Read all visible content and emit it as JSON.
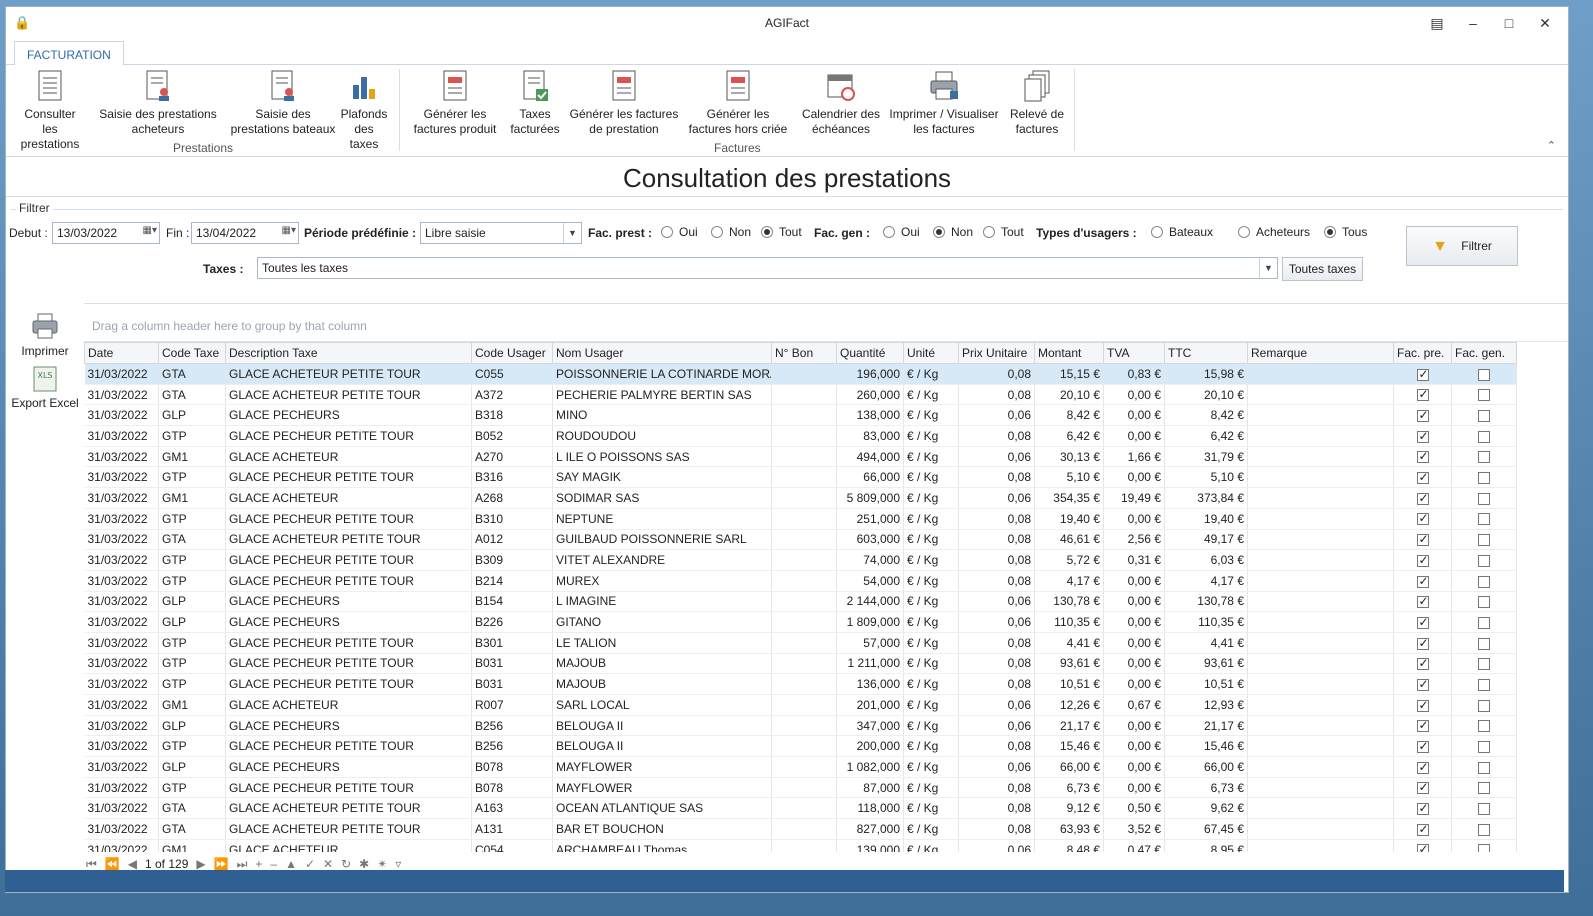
{
  "window": {
    "title": "AGIFact"
  },
  "tab": {
    "label": "FACTURATION"
  },
  "ribbon": {
    "groups": [
      {
        "label": "Prestations"
      },
      {
        "label": "Factures"
      }
    ],
    "buttons": [
      {
        "l1": "Consulter les",
        "l2": "prestations",
        "icon": "list-document-icon"
      },
      {
        "l1": "Saisie des prestations",
        "l2": "acheteurs",
        "icon": "user-document-icon"
      },
      {
        "l1": "Saisie des",
        "l2": "prestations bateaux",
        "icon": "user-document-icon"
      },
      {
        "l1": "Plafonds",
        "l2": "des taxes",
        "icon": "bar-chart-icon"
      },
      {
        "l1": "Générer les",
        "l2": "factures produit",
        "icon": "invoice-icon"
      },
      {
        "l1": "Taxes",
        "l2": "facturées",
        "icon": "check-document-icon"
      },
      {
        "l1": "Générer les factures",
        "l2": "de prestation",
        "icon": "invoice-icon"
      },
      {
        "l1": "Générer les",
        "l2": "factures hors criée",
        "icon": "invoice-icon"
      },
      {
        "l1": "Calendrier des",
        "l2": "échéances",
        "icon": "calendar-icon"
      },
      {
        "l1": "Imprimer / Visualiser",
        "l2": "les factures",
        "icon": "printer-icon"
      },
      {
        "l1": "Relevé de",
        "l2": "factures",
        "icon": "copy-documents-icon"
      }
    ]
  },
  "page": {
    "title": "Consultation des prestations"
  },
  "filter": {
    "legend": "Filtrer",
    "debut_label": "Debut :",
    "debut_value": "13/03/2022",
    "fin_label": "Fin :",
    "fin_value": "13/04/2022",
    "periode_label": "Période prédéfinie :",
    "periode_value": "Libre saisie",
    "fac_prest_label": "Fac. prest :",
    "fac_gen_label": "Fac. gen :",
    "types_label": "Types d'usagers :",
    "opt_oui": "Oui",
    "opt_non": "Non",
    "opt_tout": "Tout",
    "opt_bateaux": "Bateaux",
    "opt_acheteurs": "Acheteurs",
    "opt_tous": "Tous",
    "taxes_label": "Taxes :",
    "taxes_value": "Toutes les taxes",
    "toutes_taxes_button": "Toutes taxes",
    "filtrer_button": "Filtrer",
    "fac_prest_selected": "Tout",
    "fac_gen_selected": "Non",
    "types_selected": "Tous"
  },
  "side": {
    "print_label": "Imprimer",
    "excel_label": "Export Excel"
  },
  "grid": {
    "group_hint": "Drag a column header here to group by that column",
    "columns": [
      "Date",
      "Code Taxe",
      "Description Taxe",
      "Code Usager",
      "Nom Usager",
      "N° Bon",
      "Quantité",
      "Unité",
      "Prix Unitaire",
      "Montant",
      "TVA",
      "TTC",
      "Remarque",
      "Fac. pre.",
      "Fac. gen."
    ],
    "rows": [
      [
        "31/03/2022",
        "GTA",
        "GLACE ACHETEUR PETITE TOUR",
        "C055",
        "POISSONNERIE LA COTINARDE MORAI",
        "",
        "196,000",
        "€ / Kg",
        "0,08",
        "15,15 €",
        "0,83 €",
        "15,98 €",
        "",
        true,
        false
      ],
      [
        "31/03/2022",
        "GTA",
        "GLACE ACHETEUR PETITE TOUR",
        "A372",
        "PECHERIE PALMYRE BERTIN SAS",
        "",
        "260,000",
        "€ / Kg",
        "0,08",
        "20,10 €",
        "0,00 €",
        "20,10 €",
        "",
        true,
        false
      ],
      [
        "31/03/2022",
        "GLP",
        "GLACE PECHEURS",
        "B318",
        "MINO",
        "",
        "138,000",
        "€ / Kg",
        "0,06",
        "8,42 €",
        "0,00 €",
        "8,42 €",
        "",
        true,
        false
      ],
      [
        "31/03/2022",
        "GTP",
        "GLACE PECHEUR PETITE TOUR",
        "B052",
        "ROUDOUDOU",
        "",
        "83,000",
        "€ / Kg",
        "0,08",
        "6,42 €",
        "0,00 €",
        "6,42 €",
        "",
        true,
        false
      ],
      [
        "31/03/2022",
        "GM1",
        "GLACE ACHETEUR",
        "A270",
        "L ILE O POISSONS SAS",
        "",
        "494,000",
        "€ / Kg",
        "0,06",
        "30,13 €",
        "1,66 €",
        "31,79 €",
        "",
        true,
        false
      ],
      [
        "31/03/2022",
        "GTP",
        "GLACE PECHEUR PETITE TOUR",
        "B316",
        "SAY MAGIK",
        "",
        "66,000",
        "€ / Kg",
        "0,08",
        "5,10 €",
        "0,00 €",
        "5,10 €",
        "",
        true,
        false
      ],
      [
        "31/03/2022",
        "GM1",
        "GLACE ACHETEUR",
        "A268",
        "SODIMAR SAS",
        "",
        "5 809,000",
        "€ / Kg",
        "0,06",
        "354,35 €",
        "19,49 €",
        "373,84 €",
        "",
        true,
        false
      ],
      [
        "31/03/2022",
        "GTP",
        "GLACE PECHEUR PETITE TOUR",
        "B310",
        "NEPTUNE",
        "",
        "251,000",
        "€ / Kg",
        "0,08",
        "19,40 €",
        "0,00 €",
        "19,40 €",
        "",
        true,
        false
      ],
      [
        "31/03/2022",
        "GTA",
        "GLACE ACHETEUR PETITE TOUR",
        "A012",
        "GUILBAUD POISSONNERIE SARL",
        "",
        "603,000",
        "€ / Kg",
        "0,08",
        "46,61 €",
        "2,56 €",
        "49,17 €",
        "",
        true,
        false
      ],
      [
        "31/03/2022",
        "GTP",
        "GLACE PECHEUR PETITE TOUR",
        "B309",
        "VITET ALEXANDRE",
        "",
        "74,000",
        "€ / Kg",
        "0,08",
        "5,72 €",
        "0,31 €",
        "6,03 €",
        "",
        true,
        false
      ],
      [
        "31/03/2022",
        "GTP",
        "GLACE PECHEUR PETITE TOUR",
        "B214",
        "MUREX",
        "",
        "54,000",
        "€ / Kg",
        "0,08",
        "4,17 €",
        "0,00 €",
        "4,17 €",
        "",
        true,
        false
      ],
      [
        "31/03/2022",
        "GLP",
        "GLACE PECHEURS",
        "B154",
        "L IMAGINE",
        "",
        "2 144,000",
        "€ / Kg",
        "0,06",
        "130,78 €",
        "0,00 €",
        "130,78 €",
        "",
        true,
        false
      ],
      [
        "31/03/2022",
        "GLP",
        "GLACE PECHEURS",
        "B226",
        "GITANO",
        "",
        "1 809,000",
        "€ / Kg",
        "0,06",
        "110,35 €",
        "0,00 €",
        "110,35 €",
        "",
        true,
        false
      ],
      [
        "31/03/2022",
        "GTP",
        "GLACE PECHEUR PETITE TOUR",
        "B301",
        "LE TALION",
        "",
        "57,000",
        "€ / Kg",
        "0,08",
        "4,41 €",
        "0,00 €",
        "4,41 €",
        "",
        true,
        false
      ],
      [
        "31/03/2022",
        "GTP",
        "GLACE PECHEUR PETITE TOUR",
        "B031",
        "MAJOUB",
        "",
        "1 211,000",
        "€ / Kg",
        "0,08",
        "93,61 €",
        "0,00 €",
        "93,61 €",
        "",
        true,
        false
      ],
      [
        "31/03/2022",
        "GTP",
        "GLACE PECHEUR PETITE TOUR",
        "B031",
        "MAJOUB",
        "",
        "136,000",
        "€ / Kg",
        "0,08",
        "10,51 €",
        "0,00 €",
        "10,51 €",
        "",
        true,
        false
      ],
      [
        "31/03/2022",
        "GM1",
        "GLACE ACHETEUR",
        "R007",
        "SARL LOCAL",
        "",
        "201,000",
        "€ / Kg",
        "0,06",
        "12,26 €",
        "0,67 €",
        "12,93 €",
        "",
        true,
        false
      ],
      [
        "31/03/2022",
        "GLP",
        "GLACE PECHEURS",
        "B256",
        "BELOUGA II",
        "",
        "347,000",
        "€ / Kg",
        "0,06",
        "21,17 €",
        "0,00 €",
        "21,17 €",
        "",
        true,
        false
      ],
      [
        "31/03/2022",
        "GTP",
        "GLACE PECHEUR PETITE TOUR",
        "B256",
        "BELOUGA II",
        "",
        "200,000",
        "€ / Kg",
        "0,08",
        "15,46 €",
        "0,00 €",
        "15,46 €",
        "",
        true,
        false
      ],
      [
        "31/03/2022",
        "GLP",
        "GLACE PECHEURS",
        "B078",
        "MAYFLOWER",
        "",
        "1 082,000",
        "€ / Kg",
        "0,06",
        "66,00 €",
        "0,00 €",
        "66,00 €",
        "",
        true,
        false
      ],
      [
        "31/03/2022",
        "GTP",
        "GLACE PECHEUR PETITE TOUR",
        "B078",
        "MAYFLOWER",
        "",
        "87,000",
        "€ / Kg",
        "0,08",
        "6,73 €",
        "0,00 €",
        "6,73 €",
        "",
        true,
        false
      ],
      [
        "31/03/2022",
        "GTA",
        "GLACE ACHETEUR PETITE TOUR",
        "A163",
        "OCEAN ATLANTIQUE SAS",
        "",
        "118,000",
        "€ / Kg",
        "0,08",
        "9,12 €",
        "0,50 €",
        "9,62 €",
        "",
        true,
        false
      ],
      [
        "31/03/2022",
        "GTA",
        "GLACE ACHETEUR PETITE TOUR",
        "A131",
        "BAR ET BOUCHON",
        "",
        "827,000",
        "€ / Kg",
        "0,08",
        "63,93 €",
        "3,52 €",
        "67,45 €",
        "",
        true,
        false
      ],
      [
        "31/03/2022",
        "GM1",
        "GLACE ACHETEUR",
        "C054",
        "ARCHAMBEAU Thomas",
        "",
        "139,000",
        "€ / Kg",
        "0,06",
        "8,48 €",
        "0,47 €",
        "8,95 €",
        "",
        true,
        false
      ]
    ],
    "selected_row": 0,
    "pager": "1 of 129"
  },
  "colors": {
    "accent": "#2b6cb0",
    "selection": "#d7e9f7",
    "statusbar": "#2f5f93"
  }
}
